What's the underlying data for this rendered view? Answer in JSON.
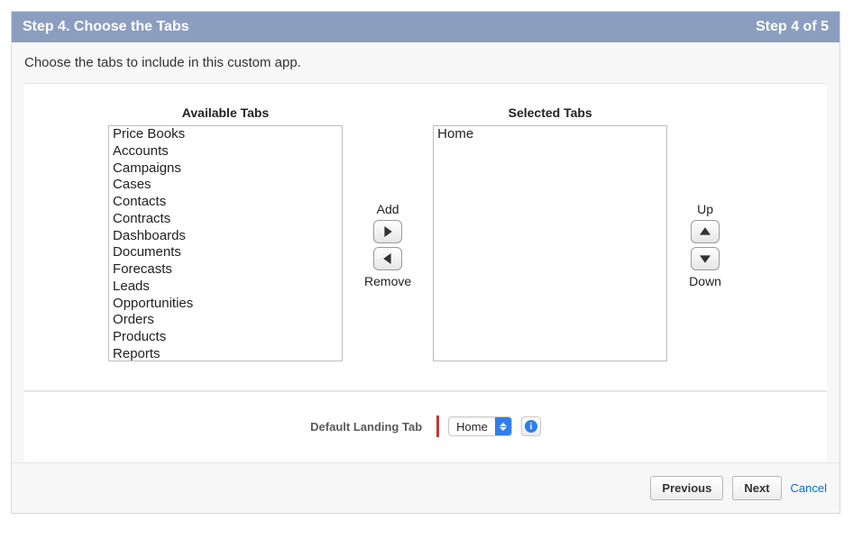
{
  "header": {
    "title": "Step 4. Choose the Tabs",
    "step": "Step 4 of 5"
  },
  "instruction": "Choose the tabs to include in this custom app.",
  "headings": {
    "available": "Available Tabs",
    "selected": "Selected Tabs"
  },
  "availableTabs": [
    "Price Books",
    "Accounts",
    "Campaigns",
    "Cases",
    "Contacts",
    "Contracts",
    "Dashboards",
    "Documents",
    "Forecasts",
    "Leads",
    "Opportunities",
    "Orders",
    "Products",
    "Reports"
  ],
  "selectedTabs": [
    "Home"
  ],
  "controls": {
    "add": "Add",
    "remove": "Remove",
    "up": "Up",
    "down": "Down"
  },
  "landing": {
    "label": "Default Landing Tab",
    "value": "Home"
  },
  "footer": {
    "previous": "Previous",
    "next": "Next",
    "cancel": "Cancel"
  }
}
